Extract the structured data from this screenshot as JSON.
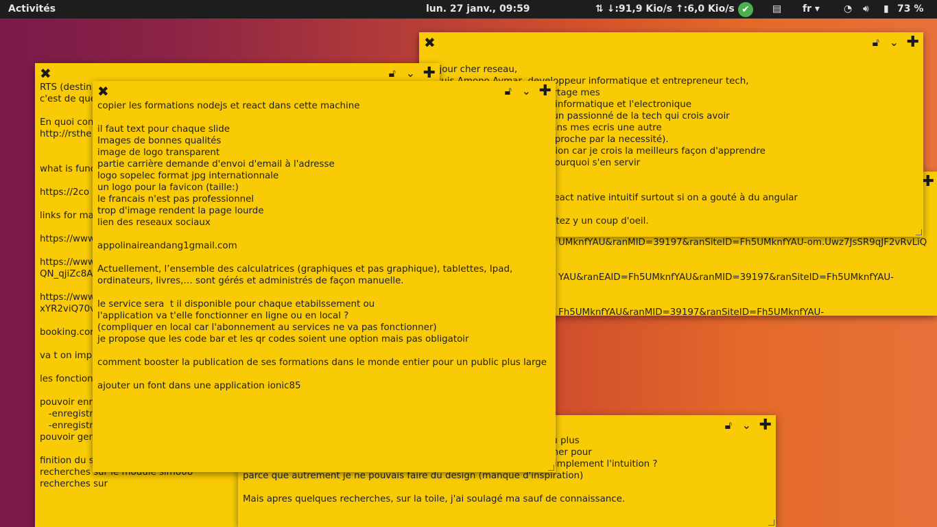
{
  "topbar": {
    "activities": "Activités",
    "clock": "lun. 27 janv., 09:59",
    "network": "⇅ ↓:91,9 Kio/s ↑:6,0 Kio/s",
    "language": "fr ▾",
    "battery": "73 %"
  },
  "notes": {
    "left": {
      "text": "RTS (destin\nc'est de que\n\nEn quoi con\nhttp://rsthe\n\n\nwhat is func\n\nhttps://2co\n\nlinks for ma\n\nhttps://www\n\nhttps://www\nQN_qjiZc8A\n\nhttps://www\nxYR2viQ70v\n\nbooking.cor\n\nva t on impr\n\nles fonction\n\npouvoir enr\n   -enregistr\n   -enregistr\npouvoir gen\n\nfinition du s\nrecherches sur le module sim808\nrecherches sur"
    },
    "topright": {
      "text": "njour cher reseau,\n suis Amono Aymar, developpeur informatique et entrepreneur tech,\n e un blog sur lequel je partage mes\n ences en programmation informatique et l'electronique\n expert absolu mais juste un passionné de la tech qui crois avoir\n artager. J'inicie là aussi dans mes ecris une autre\n elle que j'ai baptisée (l'approche par la necessité).\n robleme(Difficulté) - Solution car je crois la meilleurs façon d'apprendre\n r à quoi elle va servir et pourquoi s'en servir\n\n\n l'application en react ou react native intuitif surtout si on a gouté à du angular\n\n a vous interesse ? alors jetez y un coup d'oeil."
    },
    "behind_right": {
      "text": "UMknfYAU&ranMID=39197&ranSiteID=Fh5UMknfYAU-om.Uwz7JsSR9qJF2vRvLiQ\n\n\nYAU&ranEAID=Fh5UMknfYAU&ranMID=39197&ranSiteID=Fh5UMknfYAU-\n\n\nFh5UMknfYAU&ranMID=39197&ranSiteID=Fh5UMknfYAU-"
    },
    "bottom": {
      "text": "                                                                     pects techniques un peu plus\n                                                                     comment font les designer pour\n                                                                     ons à suivre ? ou c'est simplement l'intuition ?\nparce que autrement je ne pouvais faire du design (manque d'inspiration)\n\nMais apres quelques recherches, sur la toile, j'ai soulagé ma sauf de connaissance."
    },
    "main": {
      "text": "copier les formations nodejs et react dans cette machine\n\nil faut text pour chaque slide\nImages de bonnes qualités\nimage de logo transparent\npartie carrière demande d'envoi d'email à l'adresse\nlogo sopelec format jpg internationnale\nun logo pour la favicon (taille:)\nle francais n'est pas professionnel\ntrop d'image rendent la page lourde\nlien des reseaux sociaux\n\nappolinaireandang1gmail.com\n\nActuellement, l’ensemble des calculatrices (graphiques et pas graphique), tablettes, Ipad,\nordinateurs, livres,… sont gérés et administrés de façon manuelle.\n\nle service sera  t il disponible pour chaque etabilssement ou\nl'application va t'elle fonctionner en ligne ou en local ?\n(compliquer en local car l'abonnement au services ne va pas fonctionner)\nje propose que les code bar et les qr codes soient une option mais pas obligatoir\n\ncomment booster la publication de ses formations dans le monde entier pour un public plus large\n\najouter un font dans une application ionic85"
    }
  },
  "icons": {
    "close": "✖",
    "lock": "🔓",
    "chevron": "⌄",
    "plus": "✚"
  }
}
